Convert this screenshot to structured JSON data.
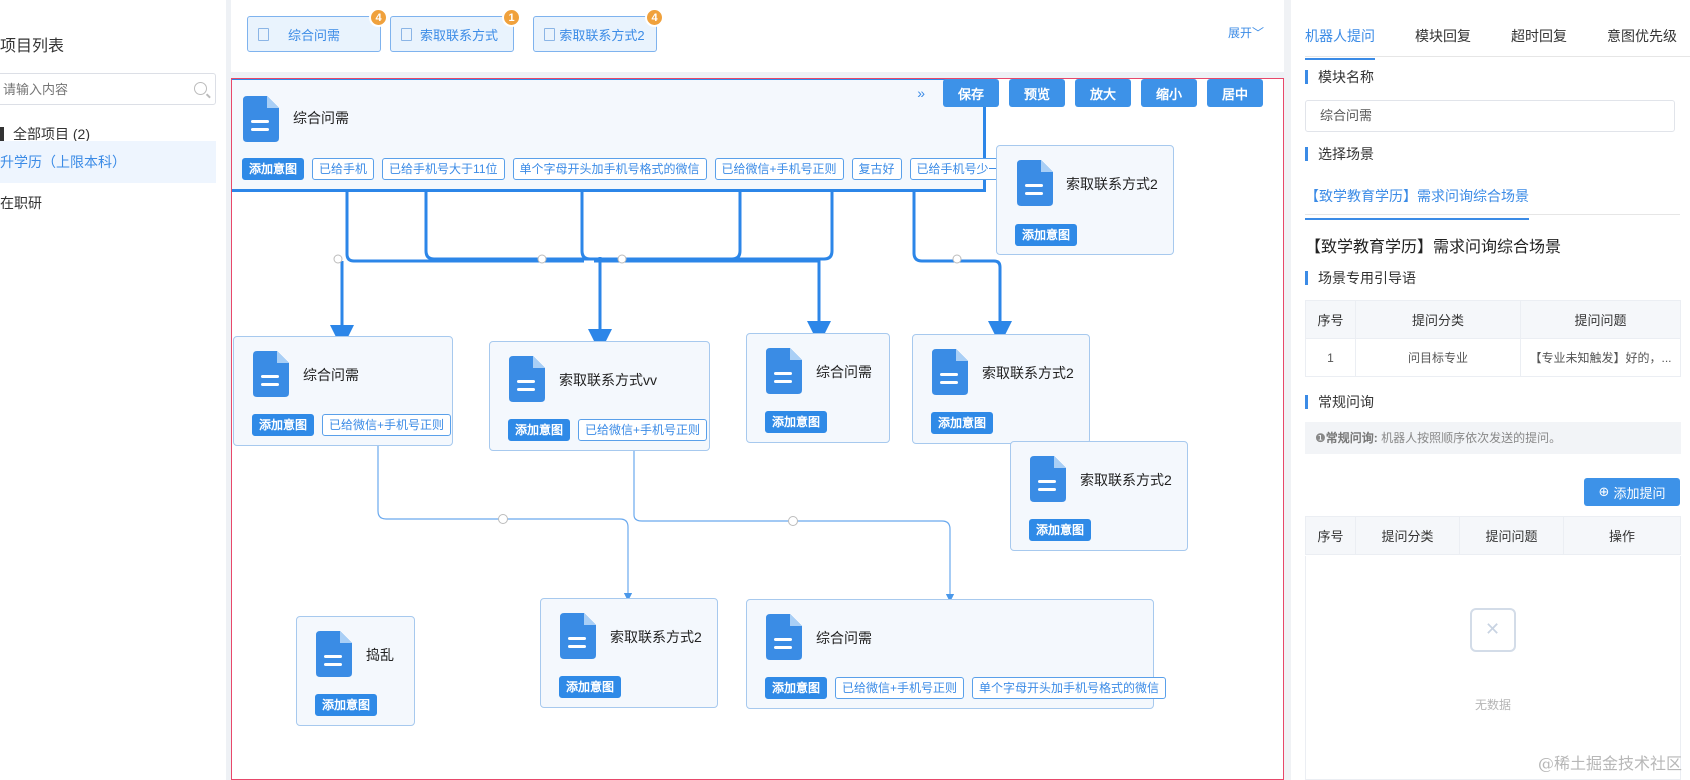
{
  "sidebar": {
    "title": "项目列表",
    "search_placeholder": "请输入内容",
    "all_projects": "全部项目 (2)",
    "items": [
      "升学历（上限本科）",
      "在职研"
    ]
  },
  "topbar": {
    "tabs": [
      {
        "label": "综合问需",
        "badge": "4"
      },
      {
        "label": "索取联系方式",
        "badge": "1"
      },
      {
        "label": "索取联系方式2",
        "badge": "4"
      }
    ],
    "expand": "展开"
  },
  "canvas": {
    "tools": [
      "保存",
      "预览",
      "放大",
      "缩小",
      "居中"
    ],
    "collapse_icon": "»",
    "add_intent": "添加意图",
    "nodes": {
      "root": {
        "title": "综合问需",
        "chips": [
          "已给手机",
          "已给手机号大于11位",
          "单个字母开头加手机号格式的微信",
          "已给微信+手机号正则",
          "复古好",
          "已给手机号少一位"
        ]
      },
      "n2": {
        "title": "索取联系方式2"
      },
      "n3": {
        "title": "综合问需",
        "chips": [
          "已给微信+手机号正则"
        ]
      },
      "n4": {
        "title": "索取联系方式vv",
        "chips": [
          "已给微信+手机号正则"
        ]
      },
      "n5": {
        "title": "综合问需"
      },
      "n6": {
        "title": "索取联系方式2"
      },
      "n7": {
        "title": "索取联系方式2"
      },
      "n8": {
        "title": "捣乱"
      },
      "n9": {
        "title": "索取联系方式2"
      },
      "n10": {
        "title": "综合问需",
        "chips": [
          "已给微信+手机号正则",
          "单个字母开头加手机号格式的微信"
        ]
      }
    }
  },
  "right_panel": {
    "tabs": [
      "机器人提问",
      "模块回复",
      "超时回复",
      "意图优先级"
    ],
    "module_name_label": "模块名称",
    "module_name_value": "综合问需",
    "scene_label": "选择场景",
    "scene_tab": "【致学教育学历】需求问询综合场景",
    "scene_title": "【致学教育学历】需求问询综合场景",
    "guide_label": "场景专用引导语",
    "guide_table": {
      "headers": [
        "序号",
        "提问分类",
        "提问问题"
      ],
      "rows": [
        [
          "1",
          "问目标专业",
          "【专业未知触发】好的，..."
        ]
      ]
    },
    "regular_label": "常规问询",
    "hint_bold": "常规问询:",
    "hint_text": " 机器人按照顺序依次发送的提问。",
    "add_question": "添加提问",
    "regular_table": {
      "headers": [
        "序号",
        "提问分类",
        "提问问题",
        "操作"
      ]
    },
    "empty_text": "无数据",
    "watermark": "@稀土掘金技术社区"
  },
  "colors": {
    "accent": "#3b8be6",
    "badge": "#f0a13c",
    "selected_border": "#2c86e8",
    "canvas_border": "#e8486a"
  }
}
